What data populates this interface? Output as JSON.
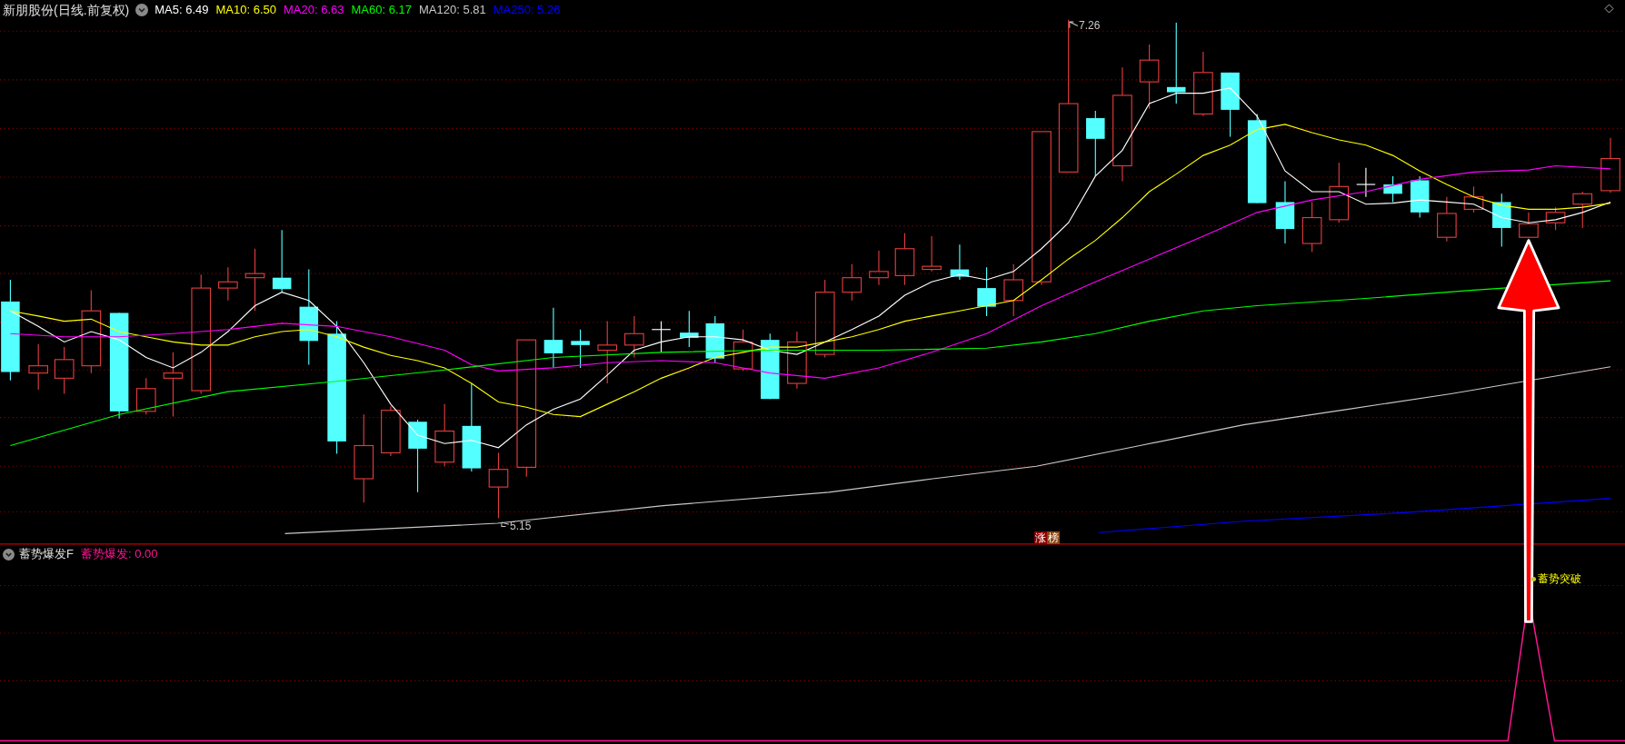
{
  "title": "新朋股份(日线.前复权)",
  "ma_legend": [
    {
      "label": "MA5: 6.49",
      "color": "#ffffff"
    },
    {
      "label": "MA10: 6.50",
      "color": "#ffff00"
    },
    {
      "label": "MA20: 6.63",
      "color": "#ff00ff"
    },
    {
      "label": "MA60: 6.17",
      "color": "#00ff00"
    },
    {
      "label": "MA120: 5.81",
      "color": "#c8c8c8"
    },
    {
      "label": "MA250: 5.26",
      "color": "#0000ff"
    }
  ],
  "price_labels": {
    "high": "7.26",
    "low": "5.15"
  },
  "badges": [
    {
      "text": "涨",
      "color": "#8b0000"
    },
    {
      "text": "榜",
      "color": "#8b4513"
    }
  ],
  "indicator": {
    "name": "蓄势爆发F",
    "value_label": "蓄势爆发: 0.00",
    "signal": "蓄势突破"
  }
}
